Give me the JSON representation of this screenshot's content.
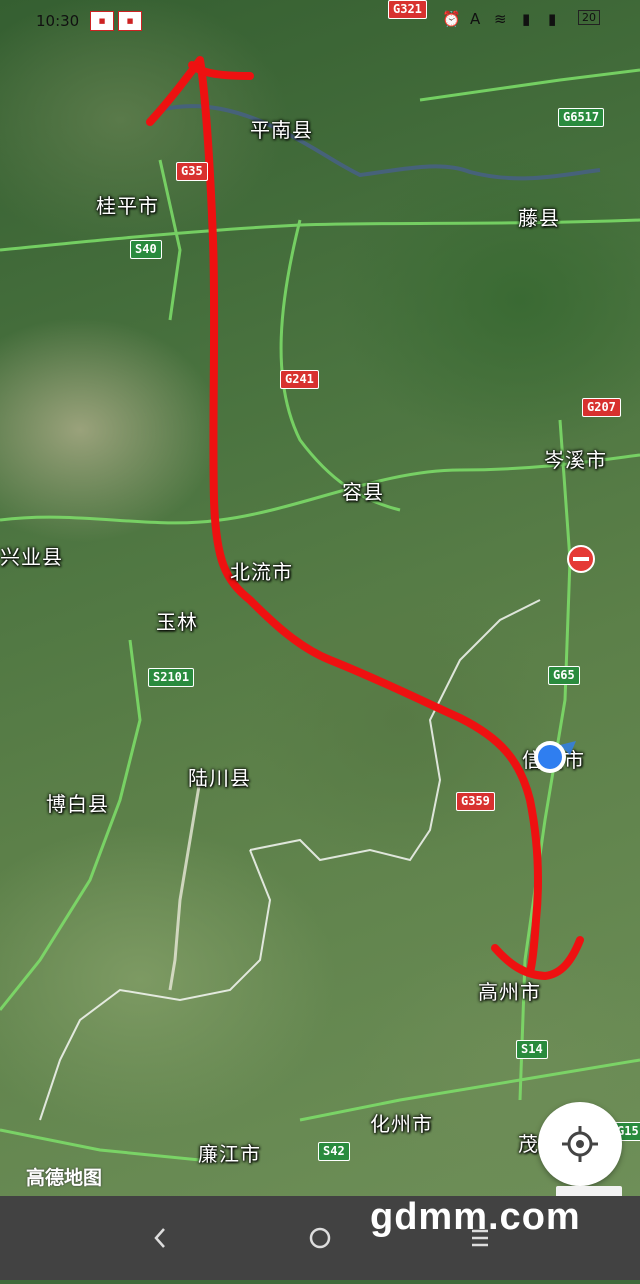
{
  "status_bar": {
    "time": "10:30",
    "battery": "20"
  },
  "places": [
    {
      "id": "pingnan",
      "name": "平南县"
    },
    {
      "id": "guiping",
      "name": "桂平市"
    },
    {
      "id": "tengxian",
      "name": "藤县"
    },
    {
      "id": "cenxi",
      "name": "岑溪市"
    },
    {
      "id": "rongxian",
      "name": "容县"
    },
    {
      "id": "xingye",
      "name": "兴业县"
    },
    {
      "id": "beiliu",
      "name": "北流市"
    },
    {
      "id": "yulin",
      "name": "玉林"
    },
    {
      "id": "luchuan",
      "name": "陆川县"
    },
    {
      "id": "bobai",
      "name": "博白县"
    },
    {
      "id": "xinyi",
      "name": "信宜市"
    },
    {
      "id": "gaozhou",
      "name": "高州市"
    },
    {
      "id": "huazhou",
      "name": "化州市"
    },
    {
      "id": "lianjiang",
      "name": "廉江市"
    },
    {
      "id": "maoming",
      "name": "茂"
    }
  ],
  "road_shields": [
    {
      "id": "g321",
      "label": "G321",
      "color": "red"
    },
    {
      "id": "g6517",
      "label": "G6517",
      "color": "green"
    },
    {
      "id": "g35",
      "label": "G35",
      "color": "red"
    },
    {
      "id": "s40",
      "label": "S40",
      "color": "green"
    },
    {
      "id": "g241",
      "label": "G241",
      "color": "red"
    },
    {
      "id": "g207",
      "label": "G207",
      "color": "red"
    },
    {
      "id": "g65",
      "label": "G65",
      "color": "green"
    },
    {
      "id": "s2101",
      "label": "S2101",
      "color": "green"
    },
    {
      "id": "g359",
      "label": "G359",
      "color": "red"
    },
    {
      "id": "s14",
      "label": "S14",
      "color": "green"
    },
    {
      "id": "s42",
      "label": "S42",
      "color": "green"
    },
    {
      "id": "g15",
      "label": "G15",
      "color": "green"
    }
  ],
  "map_logo": "高德地图",
  "watermark": "gdmm.com",
  "annotation_color": "#ee1111",
  "location_dot_color": "#2f7ef0",
  "icons": {
    "locate": "crosshair-icon",
    "back": "back-chevron-icon",
    "home": "home-circle-icon",
    "menu": "menu-lines-icon",
    "no_entry": "no-entry-icon"
  }
}
